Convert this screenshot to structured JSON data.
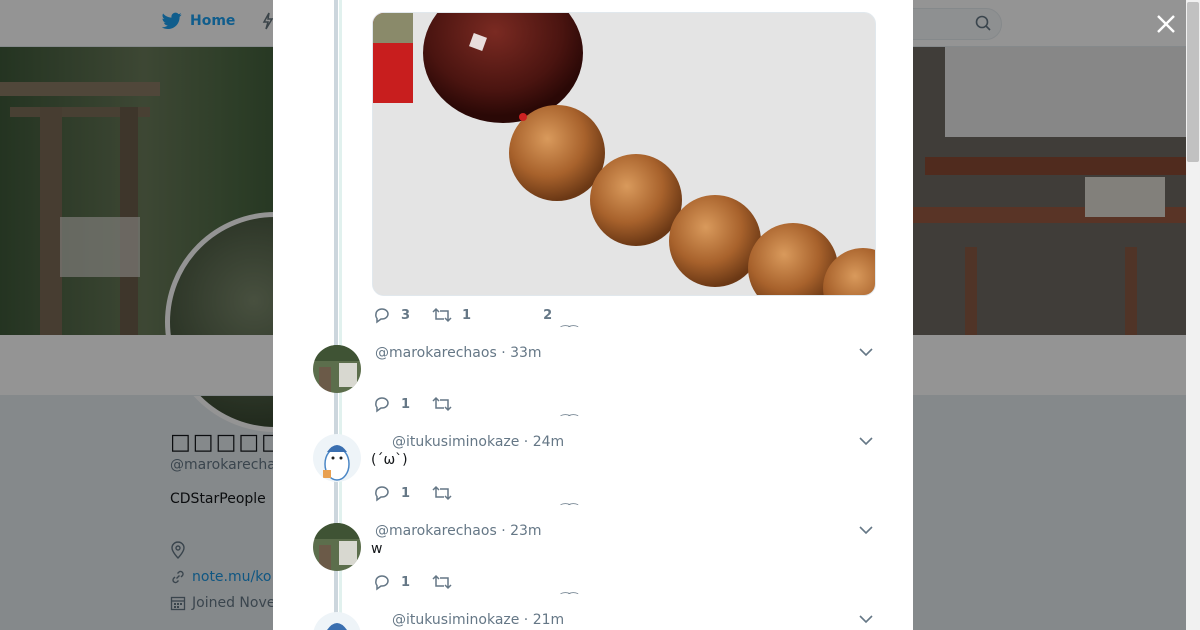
{
  "nav": {
    "home_label": "Home"
  },
  "profile": {
    "name": "□□□□□",
    "handle": "@marokarecha",
    "bio": "CDStarPeople",
    "link": "note.mu/ko",
    "joined": "Joined Nove"
  },
  "media_tweet": {
    "reply_count": "3",
    "retweet_count": "1",
    "like_count": "2"
  },
  "replies": [
    {
      "handle": "@marokarechaos",
      "time": "33m",
      "text": "",
      "reply_count": "1"
    },
    {
      "handle": "@itukusiminokaze",
      "time": "24m",
      "text": "(´ω`)",
      "reply_count": "1"
    },
    {
      "handle": "@marokarechaos",
      "time": "23m",
      "text": "w",
      "reply_count": "1"
    },
    {
      "handle": "@itukusiminokaze",
      "time": "21m",
      "text": "",
      "reply_count": ""
    }
  ],
  "colors": {
    "accent": "#1da1f2",
    "link": "#1b95e0",
    "muted": "#657786",
    "thread": "#ccd6dd"
  }
}
